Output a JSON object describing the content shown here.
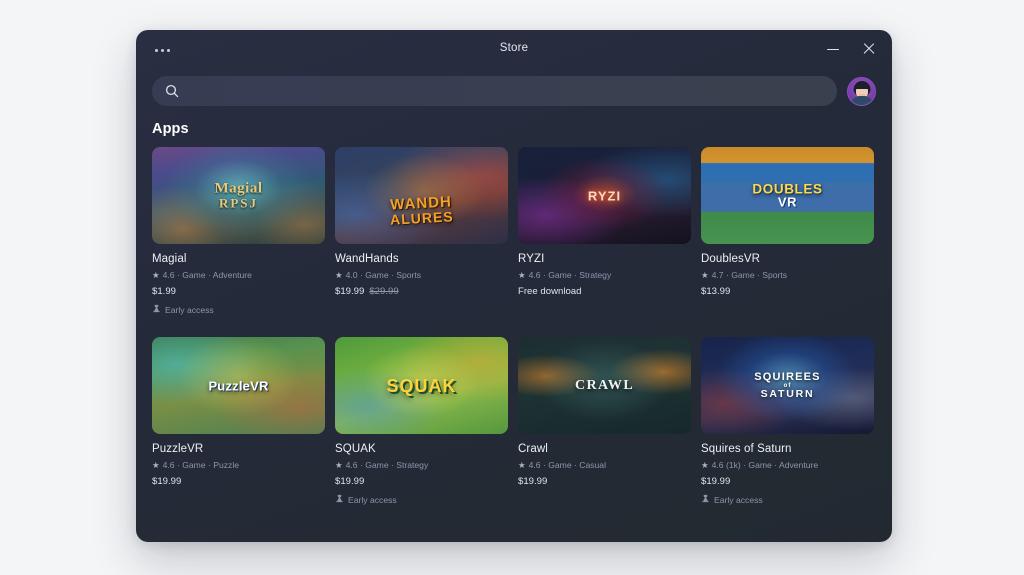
{
  "window": {
    "title": "Store",
    "menu_button": "•••",
    "minimize_label": "—",
    "close_label": "✕"
  },
  "search": {
    "value": "",
    "placeholder": "",
    "icon": "search-icon"
  },
  "account": {
    "avatar_label": "User avatar",
    "avatar_color": "#7b3fae"
  },
  "section": {
    "heading": "Apps"
  },
  "apps": [
    {
      "title": "Magial",
      "rating": "4.6",
      "category": "Game",
      "genre": "Adventure",
      "meta": "4.6 · Game · Adventure",
      "price": "$1.99",
      "price_old": "",
      "badge": "Early access",
      "logo_main": "Magial",
      "logo_sub": "RPSJ"
    },
    {
      "title": "WandHands",
      "rating": "4.0",
      "category": "Game",
      "genre": "Sports",
      "meta": "4.0 · Game · Sports",
      "price": "$19.99",
      "price_old": "$29.99",
      "badge": "",
      "logo_main": "WANDH",
      "logo_sub": "ALURES"
    },
    {
      "title": "RYZI",
      "rating": "4.6",
      "category": "Game",
      "genre": "Strategy",
      "meta": "4.6 · Game · Strategy",
      "price": "Free download",
      "price_old": "",
      "badge": "",
      "logo_main": "RYZI",
      "logo_sub": ""
    },
    {
      "title": "DoublesVR",
      "rating": "4.7",
      "category": "Game",
      "genre": "Sports",
      "meta": "4.7 · Game · Sports",
      "price": "$13.99",
      "price_old": "",
      "badge": "",
      "logo_main": "DOUBLES",
      "logo_sub": "VR"
    },
    {
      "title": "PuzzleVR",
      "rating": "4.6",
      "category": "Game",
      "genre": "Puzzle",
      "meta": "4.6 · Game · Puzzle",
      "price": "$19.99",
      "price_old": "",
      "badge": "",
      "logo_main": "PuzzleVR",
      "logo_sub": ""
    },
    {
      "title": "SQUAK",
      "rating": "4.6",
      "category": "Game",
      "genre": "Strategy",
      "meta": "4.6 · Game · Strategy",
      "price": "$19.99",
      "price_old": "",
      "badge": "Early access",
      "logo_main": "SQUAK",
      "logo_sub": ""
    },
    {
      "title": "Crawl",
      "rating": "4.6",
      "category": "Game",
      "genre": "Casual",
      "meta": "4.6 · Game · Casual",
      "price": "$19.99",
      "price_old": "",
      "badge": "",
      "logo_main": "CRAWL",
      "logo_sub": ""
    },
    {
      "title": "Squires of Saturn",
      "rating": "4.6 (1k)",
      "category": "Game",
      "genre": "Adventure",
      "meta": "4.6 (1k) · Game · Adventure",
      "price": "$19.99",
      "price_old": "",
      "badge": "Early access",
      "logo_main": "SQUIREES",
      "logo_sub": "SATURN"
    }
  ]
}
